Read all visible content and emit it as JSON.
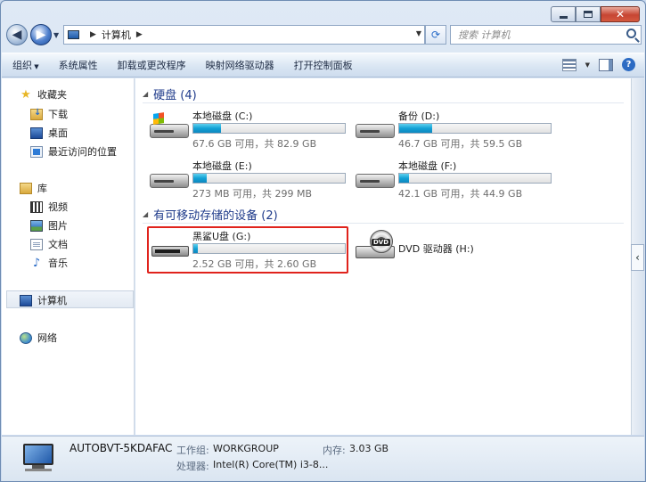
{
  "window": {
    "close_glyph": "✕"
  },
  "address": {
    "crumb": "计算机",
    "search_placeholder": "搜索 计算机"
  },
  "toolbar": {
    "items": [
      "组织",
      "系统属性",
      "卸载或更改程序",
      "映射网络驱动器",
      "打开控制面板"
    ],
    "help_glyph": "?"
  },
  "sidebar": {
    "favorites": "收藏夹",
    "downloads": "下载",
    "desktop": "桌面",
    "recent": "最近访问的位置",
    "libraries": "库",
    "videos": "视频",
    "pictures": "图片",
    "documents": "文档",
    "music": "音乐",
    "computer": "计算机",
    "network": "网络"
  },
  "groups": {
    "hard_disks": "硬盘 (4)",
    "removable": "有可移动存储的设备 (2)"
  },
  "drives": [
    {
      "name": "本地磁盘 (C:)",
      "info": "67.6 GB 可用，共 82.9 GB",
      "fill_percent": 18.5,
      "icon": "windows-hdd-icon"
    },
    {
      "name": "备份 (D:)",
      "info": "46.7 GB 可用，共 59.5 GB",
      "fill_percent": 21.5,
      "icon": "hdd-icon"
    },
    {
      "name": "本地磁盘 (E:)",
      "info": "273 MB 可用，共 299 MB",
      "fill_percent": 8.7,
      "icon": "hdd-icon"
    },
    {
      "name": "本地磁盘 (F:)",
      "info": "42.1 GB 可用，共 44.9 GB",
      "fill_percent": 6.2,
      "icon": "hdd-icon"
    }
  ],
  "removable": [
    {
      "name": "黑鲨U盘 (G:)",
      "info": "2.52 GB 可用，共 2.60 GB",
      "fill_percent": 3.1,
      "icon": "usb-drive-icon"
    },
    {
      "name": "DVD 驱动器 (H:)",
      "icon": "dvd-drive-icon",
      "dvd_label": "DVD"
    }
  ],
  "details": {
    "name": "AUTOBVT-5KDAFAC",
    "workgroup_label": "工作组:",
    "workgroup": "WORKGROUP",
    "memory_label": "内存:",
    "memory": "3.03 GB",
    "cpu_label": "处理器:",
    "cpu": "Intel(R) Core(TM) i3-8..."
  },
  "colors": {
    "highlight_border": "#e0231c",
    "bar_fill": "#13a2d6",
    "group_header": "#1e3a8a"
  }
}
